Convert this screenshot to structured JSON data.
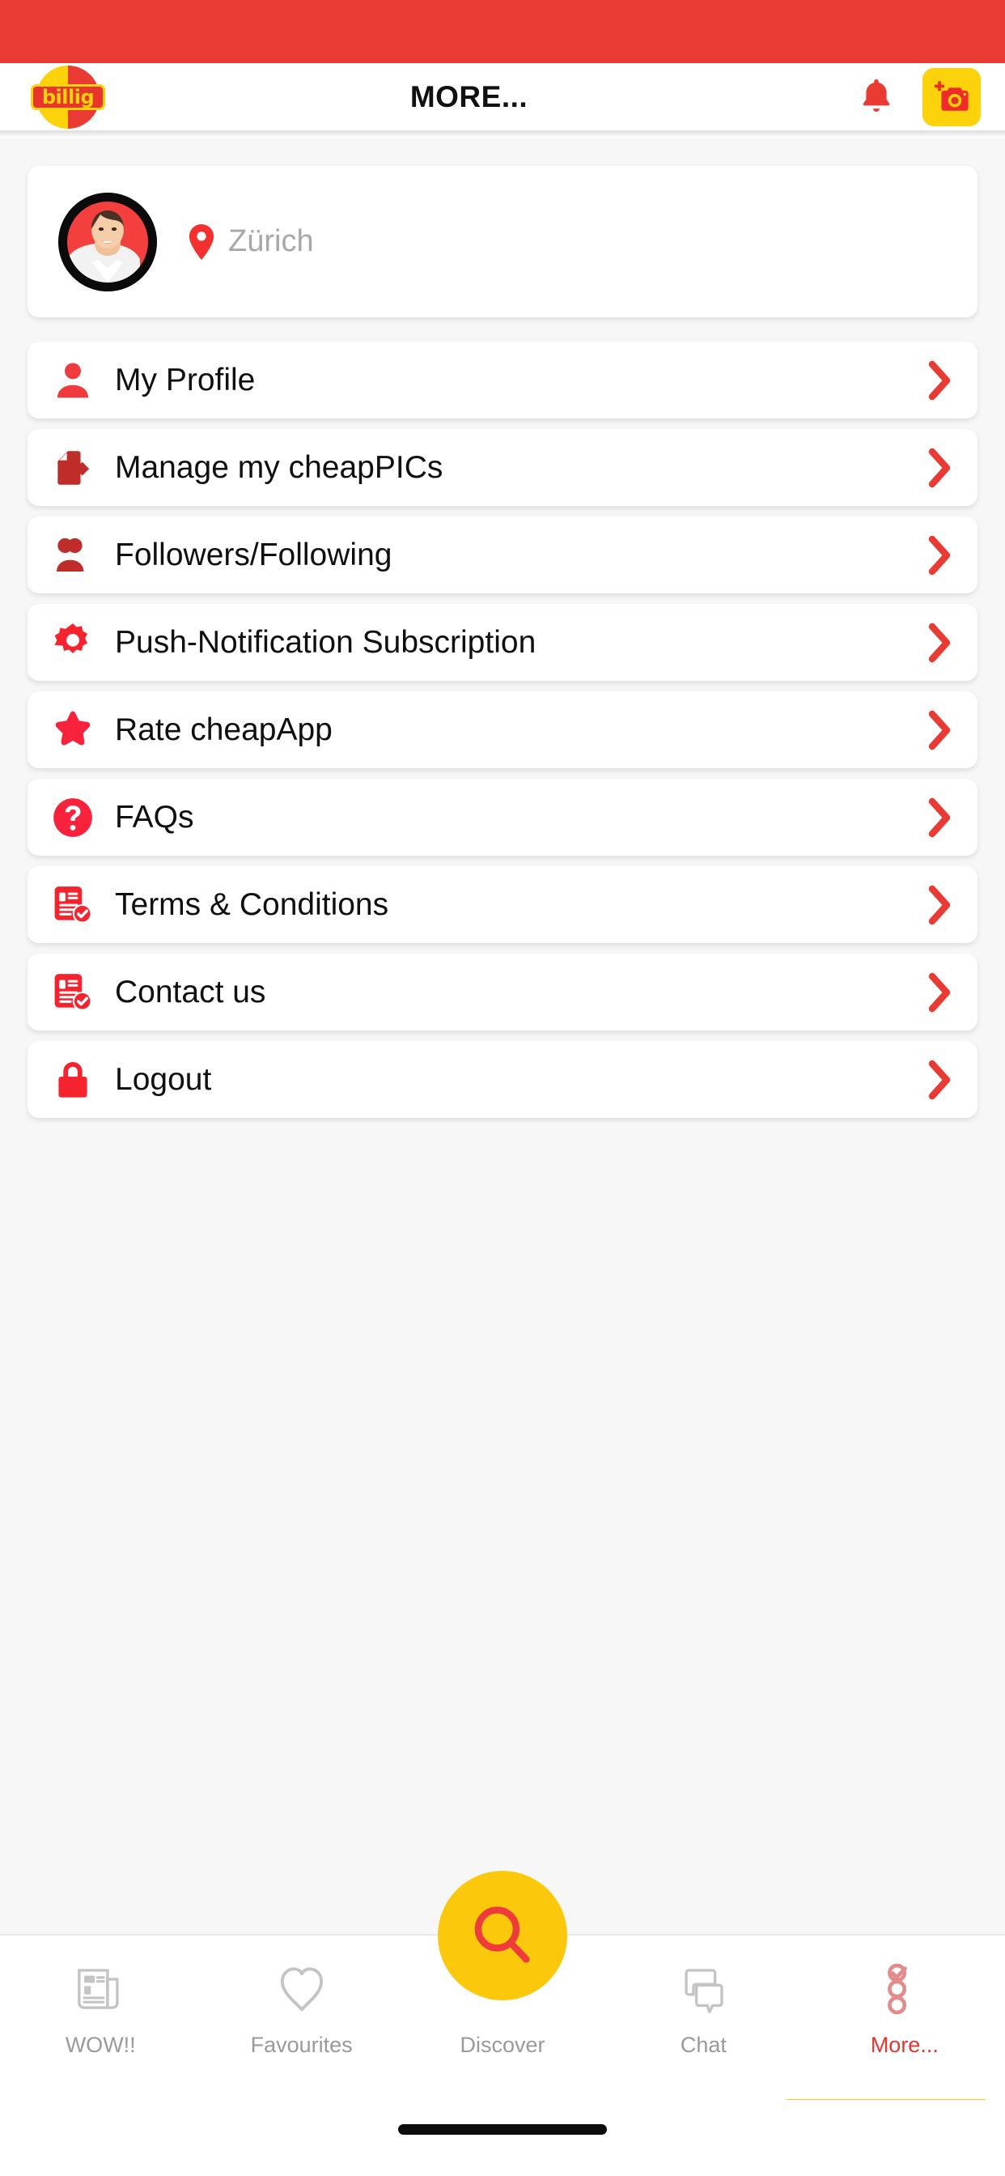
{
  "colors": {
    "brand_red": "#ea3a34",
    "brand_yellow": "#fcd20a",
    "icon_red": "#f72c3a",
    "icon_dark_red": "#bf2d2b",
    "text_dark": "#101010",
    "text_muted": "#9a9a9a",
    "page_bg": "#f7f7f7"
  },
  "status_bar": {
    "name": "status-bar"
  },
  "header": {
    "logo_text": "billig",
    "logo_icon": "billig-logo-icon",
    "title": "MORE...",
    "notification_icon": "bell-icon",
    "camera_icon": "add-photo-camera-icon"
  },
  "profile": {
    "avatar_icon": "user-avatar",
    "location_icon": "location-pin-icon",
    "location": "Zürich"
  },
  "menu": {
    "chevron_icon": "chevron-right-icon",
    "items": [
      {
        "label": "My Profile",
        "icon": "person-icon"
      },
      {
        "label": "Manage my cheapPICs",
        "icon": "edit-document-icon"
      },
      {
        "label": "Followers/Following",
        "icon": "people-group-icon"
      },
      {
        "label": "Push-Notification Subscription",
        "icon": "gear-icon"
      },
      {
        "label": "Rate cheapApp",
        "icon": "star-icon"
      },
      {
        "label": "FAQs",
        "icon": "question-circle-icon"
      },
      {
        "label": "Terms & Conditions",
        "icon": "document-check-icon"
      },
      {
        "label": "Contact us",
        "icon": "document-check-icon"
      },
      {
        "label": "Logout",
        "icon": "lock-icon"
      }
    ]
  },
  "bottom_nav": {
    "fab_icon": "search-icon",
    "tabs": [
      {
        "label": "WOW!!",
        "icon": "newspaper-icon",
        "active": false
      },
      {
        "label": "Favourites",
        "icon": "heart-icon",
        "active": false
      },
      {
        "label": "Discover",
        "icon": "search-icon",
        "active": false
      },
      {
        "label": "Chat",
        "icon": "chat-bubbles-icon",
        "active": false
      },
      {
        "label": "More...",
        "icon": "more-list-icon",
        "active": true
      }
    ]
  }
}
